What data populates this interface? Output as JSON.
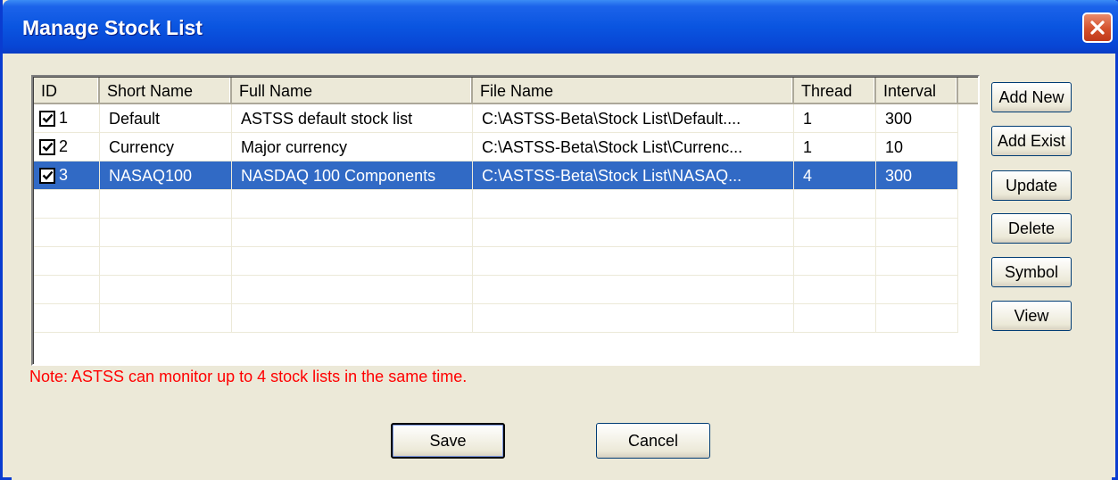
{
  "window": {
    "title": "Manage Stock List"
  },
  "list": {
    "columns": [
      {
        "label": "ID",
        "width": 74
      },
      {
        "label": "Short Name",
        "width": 148
      },
      {
        "label": "Full Name",
        "width": 270
      },
      {
        "label": "File Name",
        "width": 360
      },
      {
        "label": "Thread",
        "width": 92
      },
      {
        "label": "Interval",
        "width": 92
      }
    ],
    "rows": [
      {
        "id": "1",
        "checked": true,
        "short_name": "Default",
        "full_name": "ASTSS default stock list",
        "file_name": "C:\\ASTSS-Beta\\Stock List\\Default....",
        "thread": "1",
        "interval": "300",
        "selected": false
      },
      {
        "id": "2",
        "checked": true,
        "short_name": "Currency",
        "full_name": "Major currency",
        "file_name": "C:\\ASTSS-Beta\\Stock List\\Currenc...",
        "thread": "1",
        "interval": "10",
        "selected": false
      },
      {
        "id": "3",
        "checked": true,
        "short_name": "NASAQ100",
        "full_name": "NASDAQ 100 Components",
        "file_name": "C:\\ASTSS-Beta\\Stock List\\NASAQ...",
        "thread": "4",
        "interval": "300",
        "selected": true
      }
    ],
    "empty_rows": 5
  },
  "side_buttons": {
    "add_new": "Add New",
    "add_exist": "Add Exist",
    "update": "Update",
    "delete": "Delete",
    "symbol": "Symbol",
    "view": "View"
  },
  "note": "Note: ASTSS can monitor up to 4 stock lists in the same time.",
  "footer": {
    "save": "Save",
    "cancel": "Cancel"
  },
  "colors": {
    "title_bar": "#0a55e0",
    "selection": "#316ac5",
    "note": "#ff0000",
    "face": "#ece9d8"
  }
}
